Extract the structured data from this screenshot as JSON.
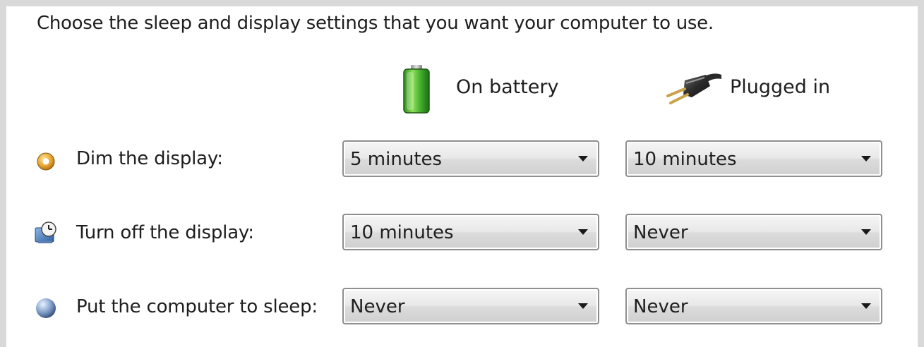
{
  "intro_text": "Choose the sleep and display settings that you want your computer to use.",
  "columns": {
    "battery": {
      "label": "On battery",
      "icon": "battery-icon"
    },
    "plugged": {
      "label": "Plugged in",
      "icon": "power-plug-icon"
    }
  },
  "rows": [
    {
      "label": "Dim the display:",
      "icon": "dim-display-icon",
      "battery_value": "5 minutes",
      "plugged_value": "10 minutes"
    },
    {
      "label": "Turn off the display:",
      "icon": "turn-off-display-icon",
      "battery_value": "10 minutes",
      "plugged_value": "Never"
    },
    {
      "label": "Put the computer to sleep:",
      "icon": "sleep-moon-icon",
      "battery_value": "Never",
      "plugged_value": "Never"
    }
  ]
}
